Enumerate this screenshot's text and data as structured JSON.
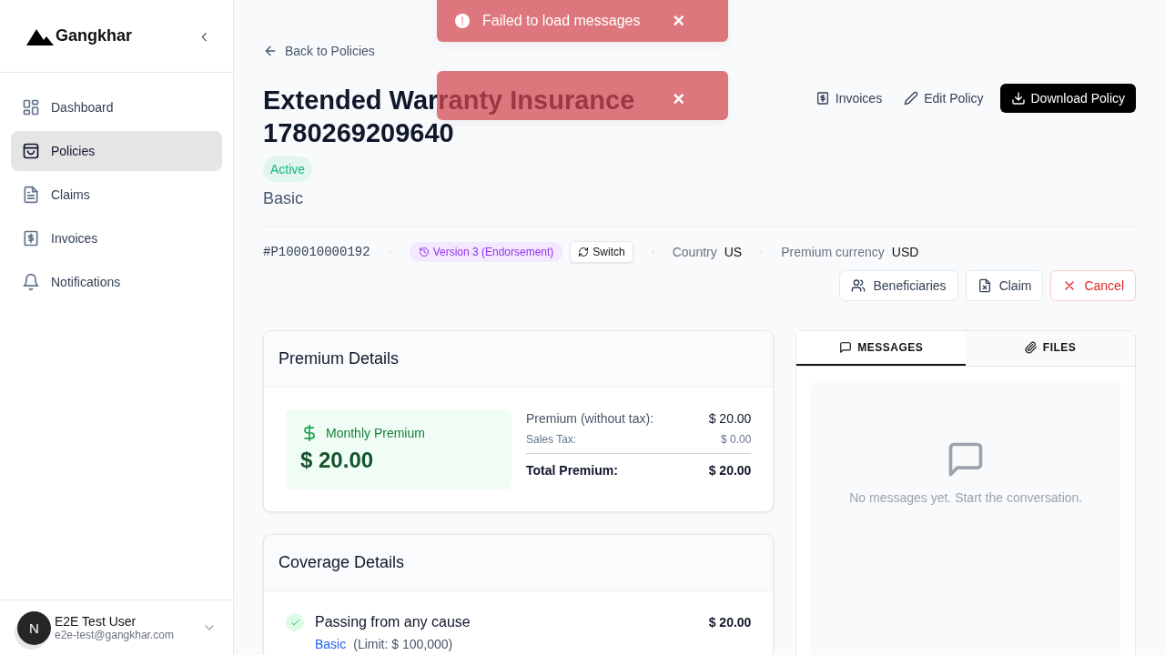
{
  "sidebar": {
    "logo": "Gangkhar",
    "collapse": "‹",
    "nav": [
      {
        "label": "Dashboard",
        "selected": false
      },
      {
        "label": "Policies",
        "selected": true
      },
      {
        "label": "Claims",
        "selected": false
      },
      {
        "label": "Invoices",
        "selected": false
      },
      {
        "label": "Notifications",
        "selected": false
      }
    ],
    "user": {
      "initial": "N",
      "name": "E2E Test User",
      "email": "e2e-test@gangkhar.com"
    }
  },
  "toasts": [
    {
      "message": "Failed to load messages",
      "close": "×"
    },
    {
      "close": "×"
    }
  ],
  "back_link": "Back to Policies",
  "policy": {
    "title": "Extended Warranty Insurance 1780269209640",
    "status": "Active",
    "plan": "Basic"
  },
  "header_actions": [
    {
      "label": "Invoices",
      "kind": "plain"
    },
    {
      "label": "Edit Policy",
      "kind": "plain"
    },
    {
      "label": "Download Policy",
      "kind": "primary"
    }
  ],
  "meta": {
    "policy_number": "#P100010000192",
    "version": "Version 3 (Endorsement)",
    "switch": "Switch",
    "country_label": "Country",
    "country": "US",
    "currency_label": "Premium currency",
    "currency": "USD"
  },
  "actions": [
    {
      "label": "Beneficiaries",
      "kind": "default"
    },
    {
      "label": "Claim",
      "kind": "default"
    },
    {
      "label": "Cancel",
      "kind": "danger"
    }
  ],
  "premium": {
    "title": "Premium Details",
    "monthly_label": "Monthly Premium",
    "monthly_amount": "$ 20.00",
    "rows": [
      {
        "label": "Premium (without tax):",
        "value": "$ 20.00",
        "kind": "normal"
      },
      {
        "label": "Sales Tax:",
        "value": "$ 0.00",
        "kind": "minor"
      },
      {
        "label": "Total Premium:",
        "value": "$ 20.00",
        "kind": "total"
      }
    ]
  },
  "coverage": {
    "title": "Coverage Details",
    "items": [
      {
        "name": "Passing from any cause",
        "amount": "$ 20.00",
        "tier": "Basic",
        "limit": "(Limit: $ 100,000)",
        "included": true
      }
    ]
  },
  "panel": {
    "tabs": [
      {
        "label": "MESSAGES",
        "selected": true
      },
      {
        "label": "FILES",
        "selected": false
      }
    ],
    "empty": "No messages yet. Start the conversation."
  }
}
